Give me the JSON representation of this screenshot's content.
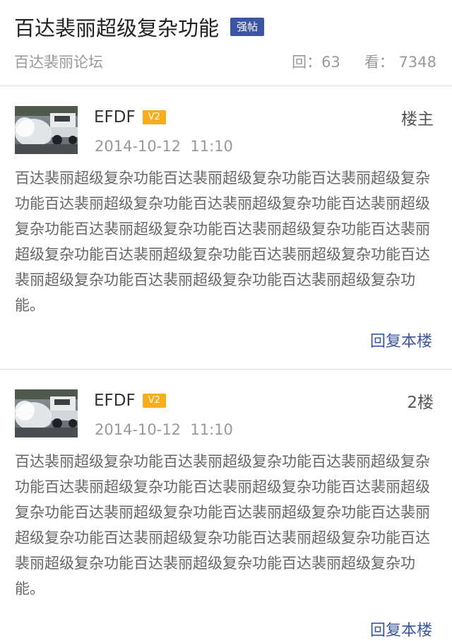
{
  "thread": {
    "title": "百达裴丽超级复杂功能",
    "tag": "强帖",
    "forum": "百达裴丽论坛",
    "replies_label": "回：63",
    "views_label": "看： 7348"
  },
  "posts": [
    {
      "author": "EFDF",
      "level": "V2",
      "floor": "楼主",
      "time": "2014-10-12  11:10",
      "content": "百达裴丽超级复杂功能百达裴丽超级复杂功能百达裴丽超级复杂功能百达裴丽超级复杂功能百达裴丽超级复杂功能百达裴丽超级复杂功能百达裴丽超级复杂功能百达裴丽超级复杂功能百达裴丽超级复杂功能百达裴丽超级复杂功能百达裴丽超级复杂功能百达裴丽超级复杂功能百达裴丽超级复杂功能百达裴丽超级复杂功能。",
      "reply_label": "回复本楼"
    },
    {
      "author": "EFDF",
      "level": "V2",
      "floor": "2楼",
      "time": "2014-10-12  11:10",
      "content": "百达裴丽超级复杂功能百达裴丽超级复杂功能百达裴丽超级复杂功能百达裴丽超级复杂功能百达裴丽超级复杂功能百达裴丽超级复杂功能百达裴丽超级复杂功能百达裴丽超级复杂功能百达裴丽超级复杂功能百达裴丽超级复杂功能百达裴丽超级复杂功能百达裴丽超级复杂功能百达裴丽超级复杂功能百达裴丽超级复杂功能。",
      "reply_label": "回复本楼"
    }
  ],
  "colors": {
    "tag_bg": "#3b55a2",
    "level_bg": "#f8ae1c",
    "reply_link": "#3b55a2",
    "divider": "#dedede"
  }
}
